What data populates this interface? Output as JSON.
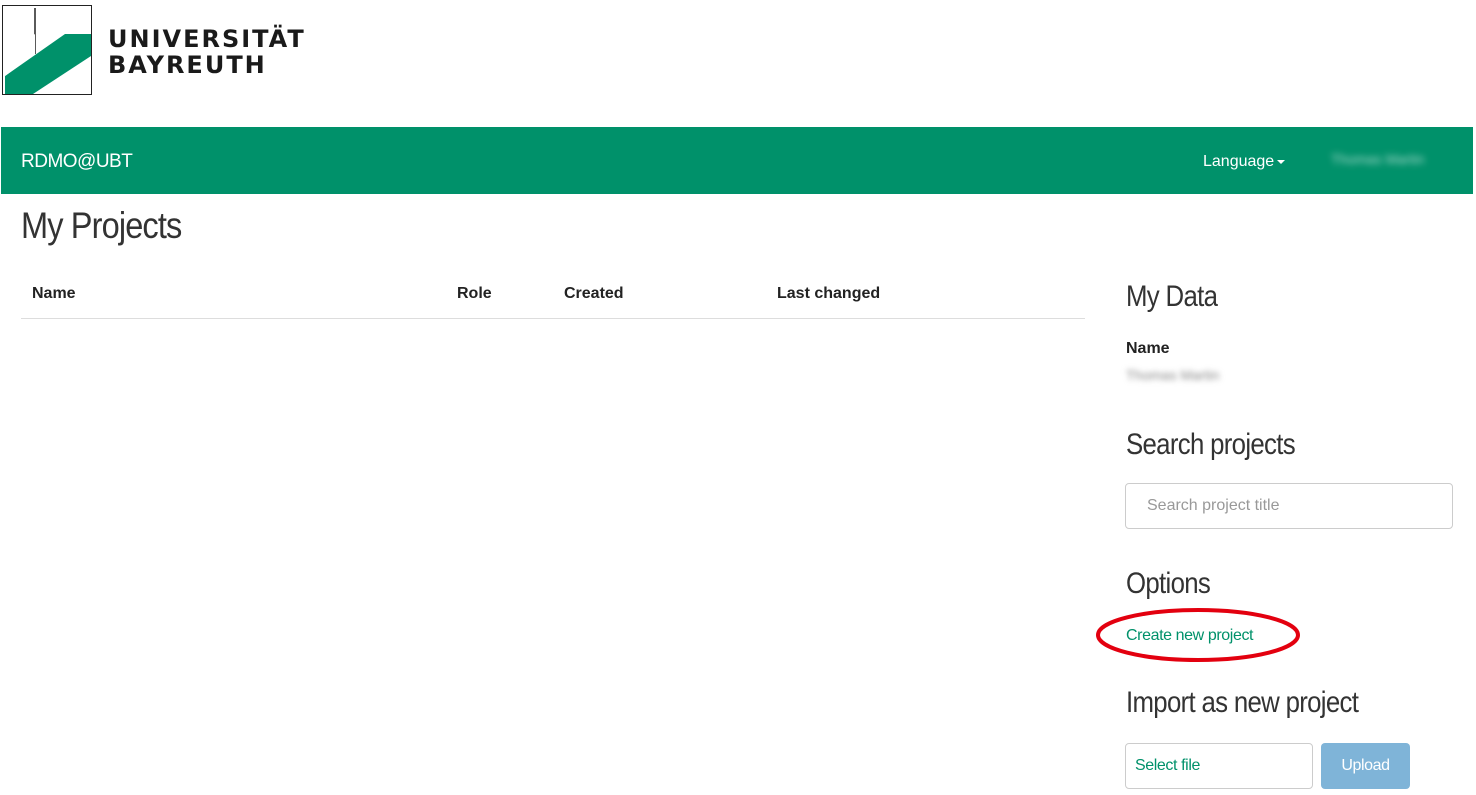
{
  "logo": {
    "line1": "UNIVERSITÄT",
    "line2": "BAYREUTH"
  },
  "navbar": {
    "brand": "RDMO@UBT",
    "language_label": "Language",
    "user_name": "Thomas Martin"
  },
  "page": {
    "title": "My Projects"
  },
  "table": {
    "columns": [
      "Name",
      "Role",
      "Created",
      "Last changed"
    ],
    "rows": []
  },
  "sidebar": {
    "my_data": {
      "heading": "My Data",
      "name_label": "Name",
      "name_value": "Thomas Martin"
    },
    "search": {
      "heading": "Search projects",
      "placeholder": "Search project title"
    },
    "options": {
      "heading": "Options",
      "create_link": "Create new project"
    },
    "import": {
      "heading": "Import as new project",
      "file_label": "Select file",
      "upload_label": "Upload"
    }
  },
  "colors": {
    "brand_green": "#00916a",
    "annotation_red": "#e3000f",
    "upload_button": "#7fb4d8"
  }
}
